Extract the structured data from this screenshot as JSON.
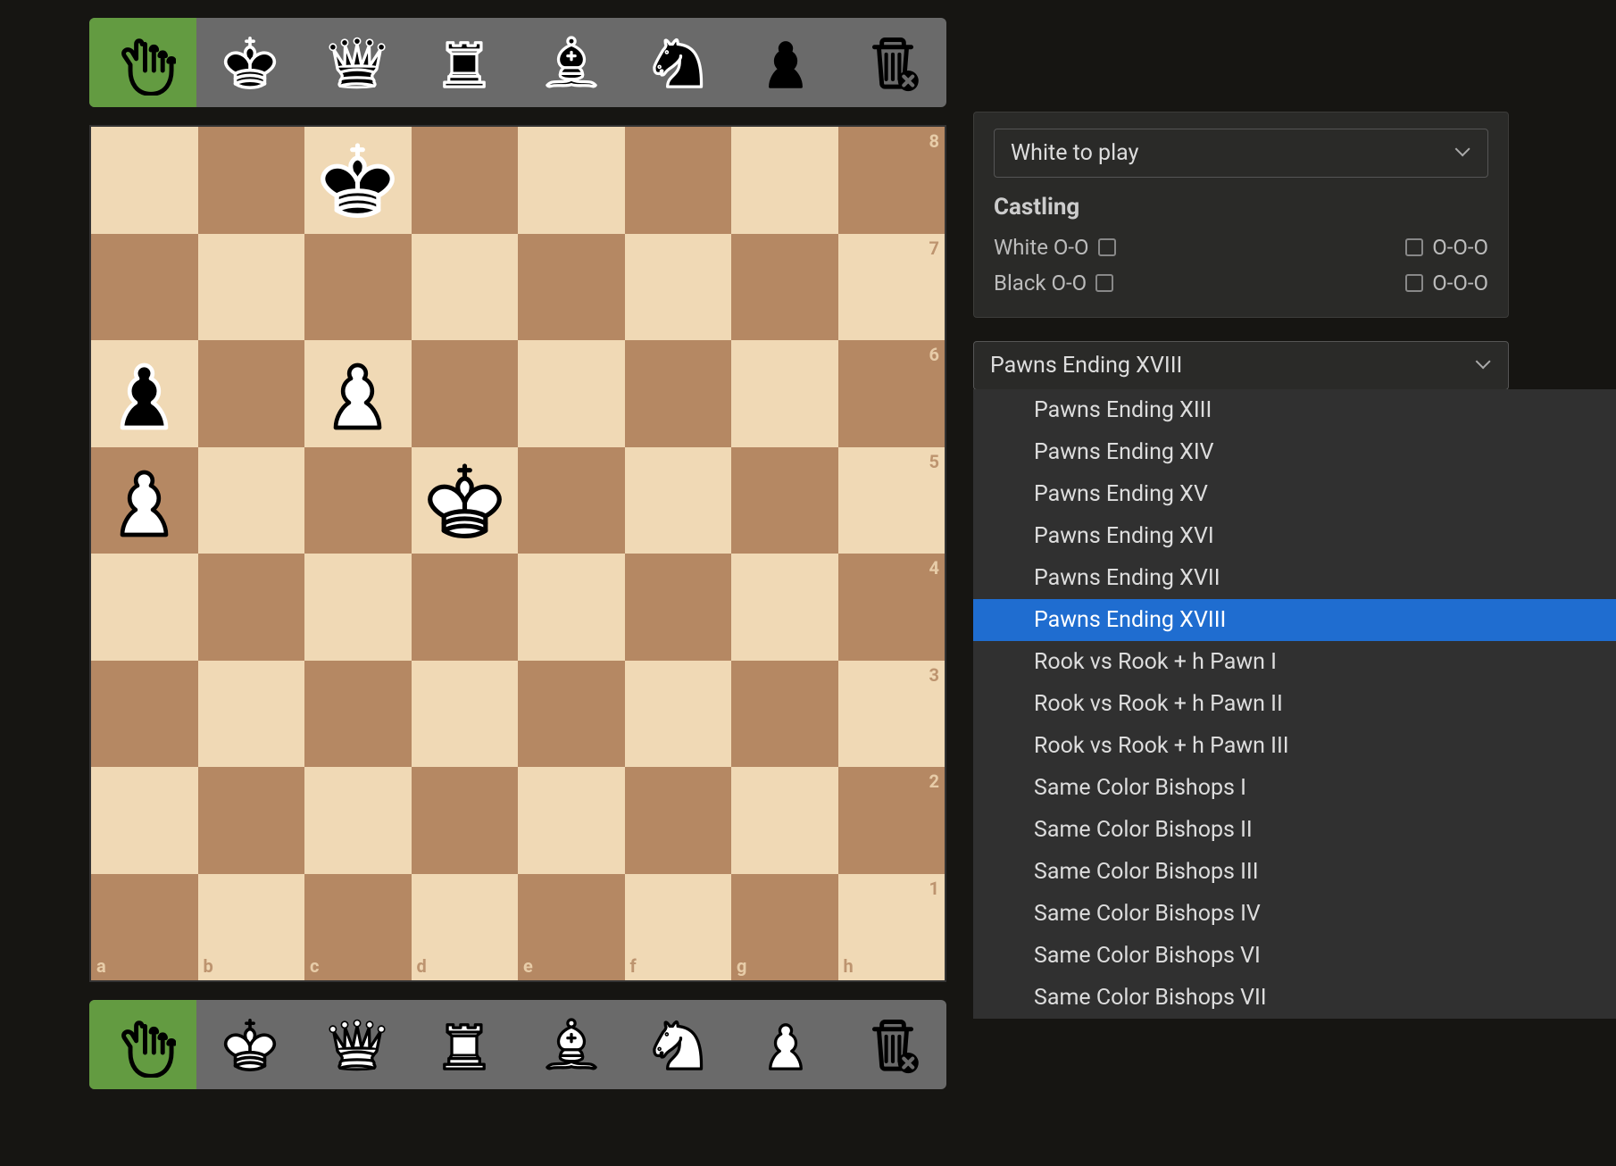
{
  "toolbar_tools": [
    "pointer",
    "king",
    "queen",
    "rook",
    "bishop",
    "knight",
    "pawn",
    "trash"
  ],
  "board": {
    "files": [
      "a",
      "b",
      "c",
      "d",
      "e",
      "f",
      "g",
      "h"
    ],
    "ranks": [
      "8",
      "7",
      "6",
      "5",
      "4",
      "3",
      "2",
      "1"
    ],
    "pieces": [
      {
        "square": "c8",
        "piece": "king",
        "color": "black"
      },
      {
        "square": "a6",
        "piece": "pawn",
        "color": "black"
      },
      {
        "square": "c6",
        "piece": "pawn",
        "color": "white"
      },
      {
        "square": "a5",
        "piece": "pawn",
        "color": "white"
      },
      {
        "square": "d5",
        "piece": "king",
        "color": "white"
      }
    ]
  },
  "sidebar": {
    "turn_label": "White to play",
    "castling": {
      "heading": "Castling",
      "white_short": "White O-O",
      "white_long": "O-O-O",
      "black_short": "Black O-O",
      "black_long": "O-O-O"
    },
    "position_select": {
      "value": "Pawns Ending XVIII",
      "options": [
        "Pawns Ending XIII",
        "Pawns Ending XIV",
        "Pawns Ending XV",
        "Pawns Ending XVI",
        "Pawns Ending XVII",
        "Pawns Ending XVIII",
        "Rook vs Rook + h Pawn I",
        "Rook vs Rook + h Pawn II",
        "Rook vs Rook + h Pawn III",
        "Same Color Bishops I",
        "Same Color Bishops II",
        "Same Color Bishops III",
        "Same Color Bishops IV",
        "Same Color Bishops VI",
        "Same Color Bishops VII"
      ]
    }
  }
}
